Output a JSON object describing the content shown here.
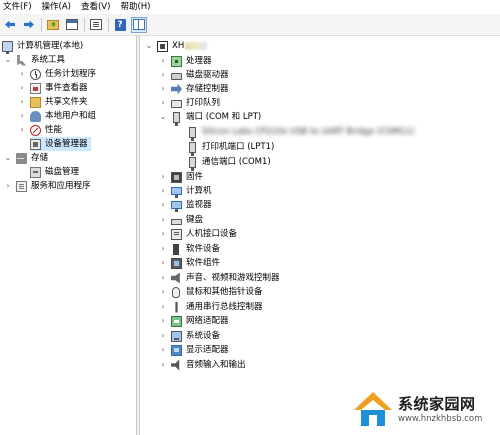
{
  "menubar": {
    "items": [
      "文件(F)",
      "操作(A)",
      "查看(V)",
      "帮助(H)"
    ]
  },
  "toolbar": {
    "buttons": [
      "back-arrow-icon",
      "forward-arrow-icon",
      "up-folder-icon",
      "show-console-tree-icon",
      "properties-icon",
      "help-icon",
      "action-pane-icon"
    ]
  },
  "tree": {
    "root": "计算机管理(本地)",
    "system_tools": {
      "label": "系统工具",
      "children": [
        "任务计划程序",
        "事件查看器",
        "共享文件夹",
        "本地用户和组",
        "性能",
        "设备管理器"
      ]
    },
    "storage": {
      "label": "存储",
      "children": [
        "磁盘管理"
      ]
    },
    "services": "服务和应用程序"
  },
  "devices": {
    "host_label": "XH",
    "categories": [
      "处理器",
      "磁盘驱动器",
      "存储控制器",
      "打印队列",
      "端口 (COM 和 LPT)",
      "固件",
      "计算机",
      "监视器",
      "键盘",
      "人机接口设备",
      "软件设备",
      "软件组件",
      "声音、视频和游戏控制器",
      "鼠标和其他指针设备",
      "通用串行总线控制器",
      "网络适配器",
      "系统设备",
      "显示适配器",
      "音频输入和输出"
    ],
    "ports_children": [
      "Silicon Labs CP210x USB to UART Bridge (COM11)",
      "打印机端口 (LPT1)",
      "通信端口 (COM1)"
    ]
  },
  "watermark": {
    "title": "系统家园网",
    "url": "www.hnzkhbsb.com"
  },
  "colors": {
    "selection": "#cce8ff",
    "toolbar_bg": "#f5f5f5",
    "watermark_orange": "#f0a020",
    "watermark_blue": "#1d8fd8"
  }
}
